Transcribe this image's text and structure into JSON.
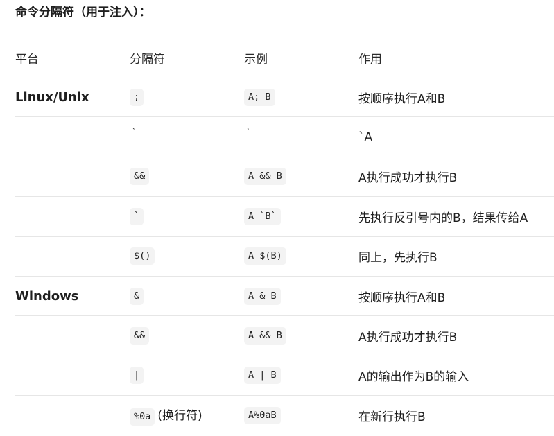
{
  "heading": "命令分隔符（用于注入）：",
  "table": {
    "headers": [
      "平台",
      "分隔符",
      "示例",
      "作用"
    ],
    "rows": [
      {
        "platform": "Linux/Unix",
        "separator": ";",
        "example": "A; B",
        "effect": "按顺序执行A和B",
        "code_style": true
      },
      {
        "platform": "",
        "separator": "`",
        "example": "`",
        "effect": "`A",
        "code_style": false
      },
      {
        "platform": "",
        "separator": "&&",
        "example": "A && B",
        "effect": "A执行成功才执行B",
        "code_style": true
      },
      {
        "platform": "",
        "separator": "`",
        "example": "A `B`",
        "effect": "先执行反引号内的B，结果传给A",
        "code_style": true
      },
      {
        "platform": "",
        "separator": "$()",
        "example": "A $(B)",
        "effect": "同上，先执行B",
        "code_style": true
      },
      {
        "platform": "Windows",
        "separator": "&",
        "example": "A & B",
        "effect": "按顺序执行A和B",
        "code_style": true
      },
      {
        "platform": "",
        "separator": "&&",
        "example": "A && B",
        "effect": "A执行成功才执行B",
        "code_style": true
      },
      {
        "platform": "",
        "separator": "|",
        "example": "A | B",
        "effect": "A的输出作为B的输入",
        "code_style": true
      },
      {
        "platform": "",
        "separator": "%0a",
        "separator_note": "(换行符)",
        "example": "A%0aB",
        "effect": "在新行执行B",
        "code_style": true
      }
    ]
  }
}
